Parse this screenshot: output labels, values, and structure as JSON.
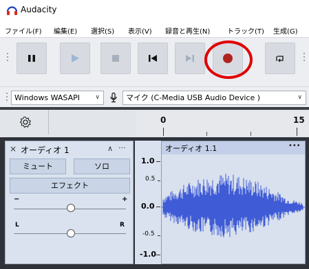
{
  "app": {
    "title": "Audacity"
  },
  "menu": [
    "ファイル(F)",
    "編集(E)",
    "選択(S)",
    "表示(V)",
    "録音と再生(N)",
    "トラック(T)",
    "生成(G)"
  ],
  "transport": {
    "pause": "pause-icon",
    "play": "play-icon",
    "stop": "stop-icon",
    "skip_start": "skip-to-start-icon",
    "skip_end": "skip-to-end-icon",
    "record": "record-icon",
    "loop": "loop-icon",
    "record_color": "#b0231f",
    "annotation_color": "#e00000"
  },
  "device": {
    "host": "Windows WASAPI",
    "input": "マイク (C-Media USB Audio Device  )"
  },
  "timeline": {
    "ticks": [
      "0",
      "15"
    ]
  },
  "track": {
    "name": "オーディオ 1",
    "mute": "ミュート",
    "solo": "ソロ",
    "effects": "エフェクト",
    "gain_minus": "−",
    "gain_plus": "+",
    "pan_left": "L",
    "pan_right": "R",
    "close": "×",
    "collapse": "∧",
    "more": "···",
    "clip_name": "オーディオ 1.1",
    "clip_more": "•••",
    "waveform_color": "#3f5bd6"
  },
  "vruler": [
    "1.0",
    "0.5",
    "0.0",
    "-0.5",
    "-1.0"
  ]
}
